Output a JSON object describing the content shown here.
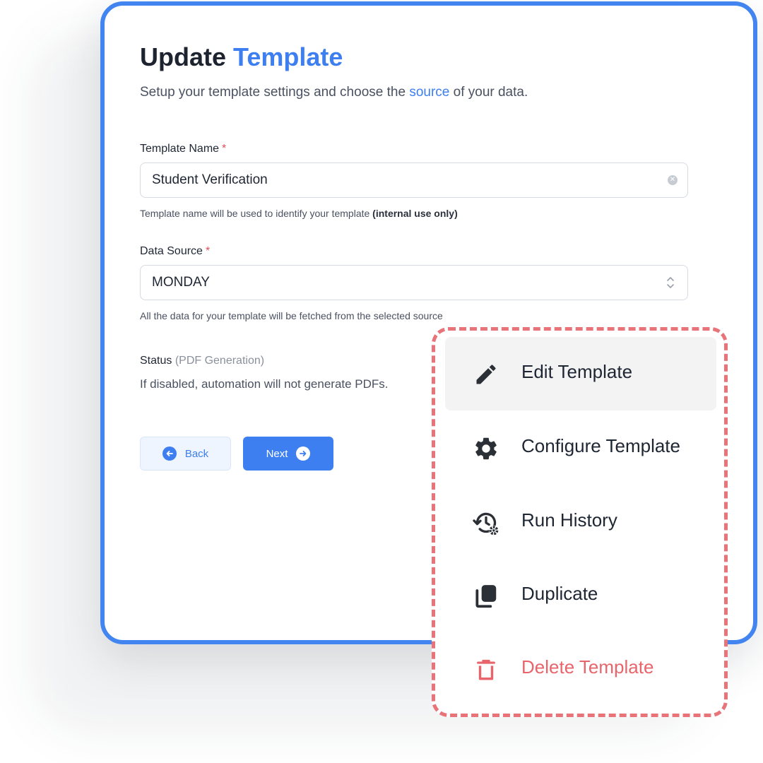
{
  "form": {
    "title_part1": "Update",
    "title_part2": "Template",
    "subtitle_before": "Setup your template settings and choose the ",
    "subtitle_link": "source",
    "subtitle_after": " of your data.",
    "template_name": {
      "label": "Template Name",
      "required_mark": "*",
      "value": "Student Verification",
      "help_text": "Template name will be used to identify your template ",
      "help_bold": "(internal use only)"
    },
    "data_source": {
      "label": "Data Source",
      "required_mark": "*",
      "value": "MONDAY",
      "help_text": "All the data for your template will be fetched from the selected source"
    },
    "status": {
      "label": "Status",
      "label_muted": "(PDF Generation)",
      "description": "If disabled, automation will not generate PDFs."
    },
    "buttons": {
      "back": "Back",
      "next": "Next"
    }
  },
  "menu": {
    "items": [
      {
        "label": "Edit Template",
        "icon": "pencil-icon",
        "highlighted": true
      },
      {
        "label": "Configure Template",
        "icon": "gear-icon"
      },
      {
        "label": "Run History",
        "icon": "history-settings-icon"
      },
      {
        "label": "Duplicate",
        "icon": "duplicate-icon"
      },
      {
        "label": "Delete Template",
        "icon": "trash-icon",
        "danger": true
      }
    ]
  },
  "colors": {
    "accent": "#3d7ff0",
    "card_border": "#4285f0",
    "danger": "#e8656b",
    "menu_border": "#e8747a"
  }
}
